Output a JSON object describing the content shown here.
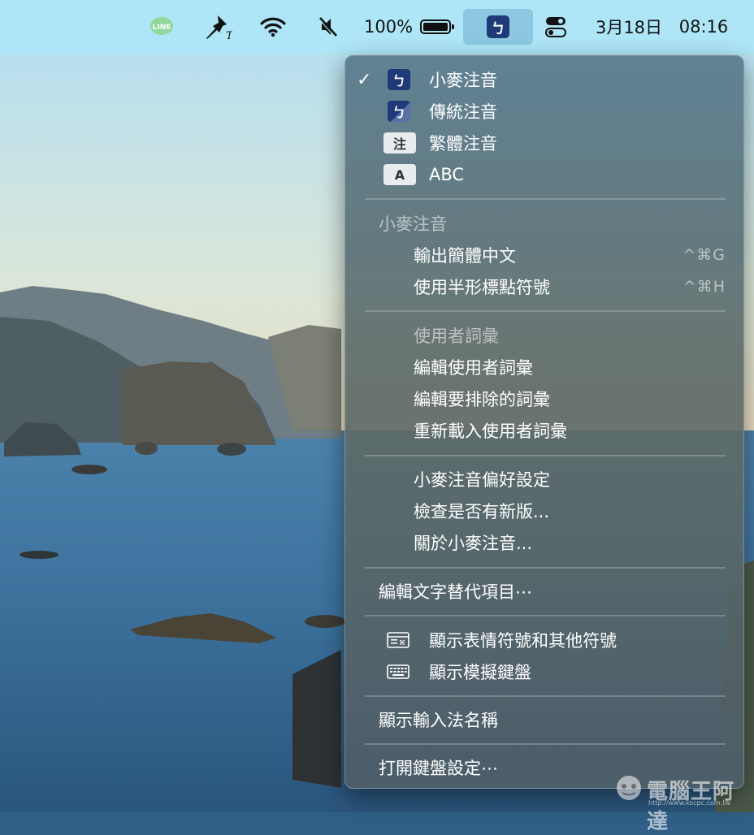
{
  "menubar": {
    "battery_percent": "100%",
    "date": "3月18日",
    "time": "08:16",
    "input_source_glyph": "ㄅ",
    "icons": [
      "line-icon",
      "pin-icon",
      "wifi-icon",
      "mute-icon",
      "battery-icon",
      "input-source-icon",
      "control-center-icon"
    ]
  },
  "menu": {
    "input_methods": [
      {
        "label": "小麥注音",
        "badge": "ㄅ",
        "checked": true
      },
      {
        "label": "傳統注音",
        "badge": "ㄅ",
        "checked": false
      },
      {
        "label": "繁體注音",
        "badge": "注",
        "checked": false
      },
      {
        "label": "ABC",
        "badge": "A",
        "checked": false
      }
    ],
    "section_title": "小麥注音",
    "options": [
      {
        "label": "輸出簡體中文",
        "shortcut": "^⌘G"
      },
      {
        "label": "使用半形標點符號",
        "shortcut": "^⌘H"
      }
    ],
    "user_phrases_title": "使用者詞彙",
    "user_phrases": [
      "編輯使用者詞彙",
      "編輯要排除的詞彙",
      "重新載入使用者詞彙"
    ],
    "app_items": [
      "小麥注音偏好設定",
      "檢查是否有新版...",
      "關於小麥注音..."
    ],
    "edit_text_replacement": "編輯文字替代項目⋯",
    "emoji_viewer": "顯示表情符號和其他符號",
    "keyboard_viewer": "顯示模擬鍵盤",
    "show_input_source_name": "顯示輸入法名稱",
    "open_keyboard_settings": "打開鍵盤設定⋯"
  },
  "watermark": {
    "text": "電腦王阿達",
    "url": "http://www.kocpc.com.tw"
  }
}
